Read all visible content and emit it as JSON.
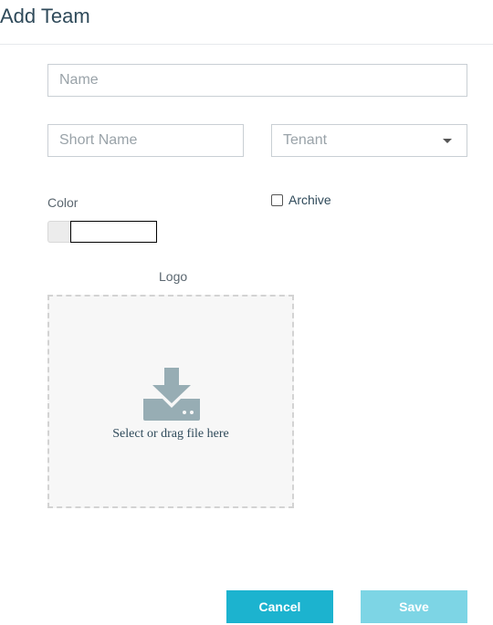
{
  "dialog": {
    "title": "Add Team"
  },
  "form": {
    "name_placeholder": "Name",
    "short_name_placeholder": "Short Name",
    "tenant_placeholder": "Tenant",
    "color_label": "Color",
    "archive_label": "Archive",
    "archive_checked": false,
    "logo_label": "Logo",
    "dropzone_text": "Select or drag file here",
    "dropzone_icon": "download-icon"
  },
  "actions": {
    "cancel_label": "Cancel",
    "save_label": "Save",
    "save_enabled": false
  },
  "colors": {
    "primary": "#1cb3cf",
    "primary_disabled": "#7dd5e5",
    "icon": "#97adb4"
  }
}
